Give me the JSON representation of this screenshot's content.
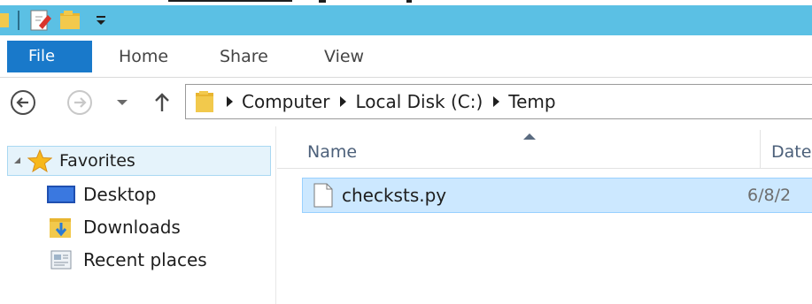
{
  "ribbon": {
    "tabs": [
      "File",
      "Home",
      "Share",
      "View"
    ]
  },
  "address": {
    "crumbs": [
      "Computer",
      "Local Disk (C:)",
      "Temp"
    ]
  },
  "navigation": {
    "favorites_label": "Favorites",
    "items": [
      "Desktop",
      "Downloads",
      "Recent places"
    ]
  },
  "file_list": {
    "columns": [
      "Name",
      "Date"
    ],
    "rows": [
      {
        "name": "checksts.py",
        "date": "6/8/2"
      }
    ]
  },
  "colors": {
    "titlebar": "#5bc0e4",
    "file_tab": "#1979ca",
    "selection": "#cce8ff",
    "folder": "#f2c94c"
  }
}
